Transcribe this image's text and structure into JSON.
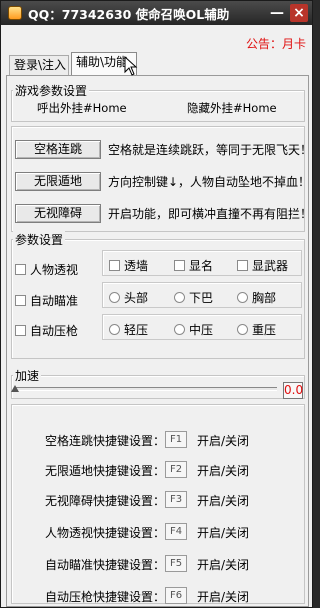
{
  "window": {
    "title": "QQ：77342630 使命召唤OL辅助",
    "minimize": "—",
    "close": "×"
  },
  "notice": "公告：月卡",
  "tabs": [
    "登录\\注入",
    "辅助\\功能"
  ],
  "game_params": {
    "title": "游戏参数设置",
    "call_hotkey": "呼出外挂#Home",
    "hide_hotkey": "隐藏外挂#Home"
  },
  "features": [
    {
      "button": "空格连跳",
      "desc": "空格就是连续跳跃，等同于无限飞天！"
    },
    {
      "button": "无限遁地",
      "desc": "方向控制键↓，人物自动坠地不掉血！"
    },
    {
      "button": "无视障碍",
      "desc": "开启功能，即可横冲直撞不再有阻拦！"
    }
  ],
  "params": {
    "title": "参数设置",
    "left": [
      "人物透视",
      "自动瞄准",
      "自动压枪"
    ],
    "row1": [
      "透墙",
      "显名",
      "显武器"
    ],
    "row2": [
      "头部",
      "下巴",
      "胸部"
    ],
    "row3": [
      "轻压",
      "中压",
      "重压"
    ]
  },
  "speed": {
    "title": "加速",
    "value": "0.0",
    "level": 0.0
  },
  "hotkeys": [
    {
      "label": "空格连跳快捷键设置：",
      "key": "F1",
      "toggle": "开启/关闭"
    },
    {
      "label": "无限遁地快捷键设置：",
      "key": "F2",
      "toggle": "开启/关闭"
    },
    {
      "label": "无视障碍快捷键设置：",
      "key": "F3",
      "toggle": "开启/关闭"
    },
    {
      "label": "人物透视快捷键设置：",
      "key": "F4",
      "toggle": "开启/关闭"
    },
    {
      "label": "自动瞄准快捷键设置：",
      "key": "F5",
      "toggle": "开启/关闭"
    },
    {
      "label": "自动压枪快捷键设置：",
      "key": "F6",
      "toggle": "开启/关闭"
    }
  ]
}
